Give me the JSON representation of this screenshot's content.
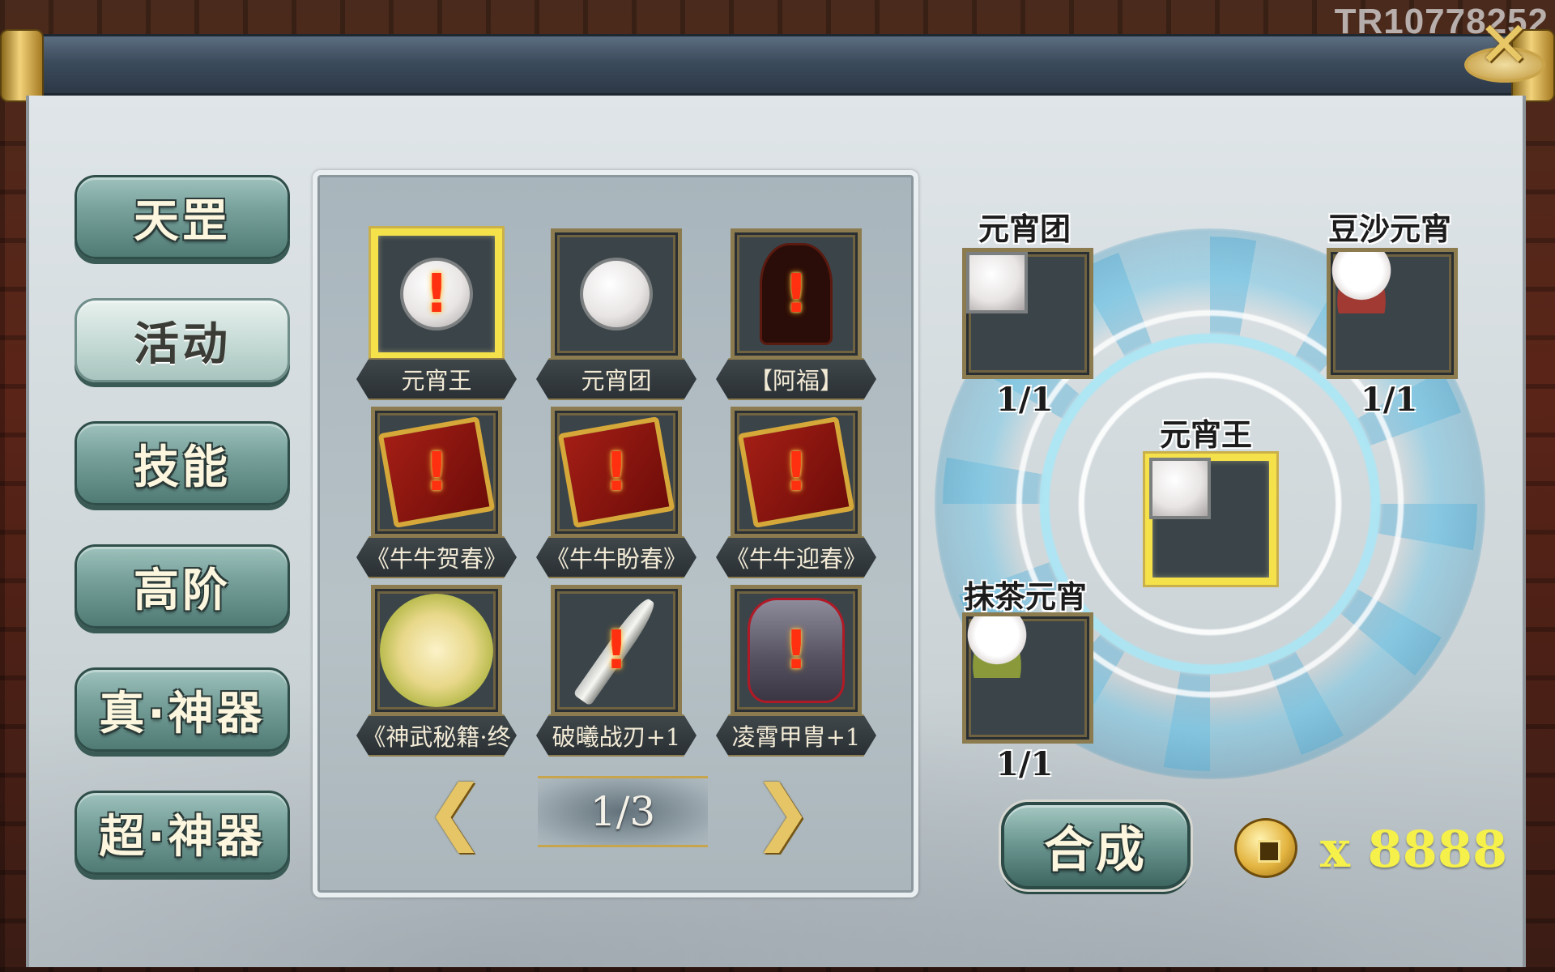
{
  "watermark": "TR10778252",
  "sidebar": {
    "items": [
      {
        "label": "天罡",
        "active": false
      },
      {
        "label": "活动",
        "active": true
      },
      {
        "label": "技能",
        "active": false
      },
      {
        "label": "高阶",
        "active": false
      },
      {
        "label": "真·神器",
        "active": false
      },
      {
        "label": "超·神器",
        "active": false
      }
    ]
  },
  "grid": {
    "items": [
      {
        "label": "元宵王",
        "icon": "yuanxiao-king-icon",
        "alert": "!",
        "selected": true
      },
      {
        "label": "元宵团",
        "icon": "yuanxiao-ball-icon",
        "alert": "",
        "selected": false
      },
      {
        "label": "【阿福】",
        "icon": "afu-icon",
        "alert": "!",
        "selected": false
      },
      {
        "label": "《牛牛贺春》",
        "icon": "book-icon",
        "alert": "!",
        "selected": false
      },
      {
        "label": "《牛牛盼春》",
        "icon": "book-icon",
        "alert": "!",
        "selected": false
      },
      {
        "label": "《牛牛迎春》",
        "icon": "book-icon",
        "alert": "!",
        "selected": false
      },
      {
        "label": "《神武秘籍·终",
        "icon": "scroll-icon",
        "alert": "",
        "selected": false
      },
      {
        "label": "破曦战刃+1",
        "icon": "blade-icon",
        "alert": "!",
        "selected": false
      },
      {
        "label": "凌霄甲胄+1",
        "icon": "armor-icon",
        "alert": "!",
        "selected": false
      }
    ]
  },
  "pagination": {
    "current": "1/3",
    "prev_icon": "arrow-left-icon",
    "next_icon": "arrow-right-icon"
  },
  "synthesis": {
    "materials": [
      {
        "name": "元宵团",
        "count": "1/1",
        "icon": "yuanxiao-ball-icon"
      },
      {
        "name": "豆沙元宵",
        "count": "1/1",
        "icon": "redbean-yuanxiao-icon"
      },
      {
        "name": "抹茶元宵",
        "count": "1/1",
        "icon": "matcha-yuanxiao-icon"
      }
    ],
    "result": {
      "name": "元宵王",
      "icon": "yuanxiao-king-icon"
    },
    "compose_label": "合成",
    "currency_icon": "copper-coin-icon",
    "currency_amount": "x 8888"
  },
  "colors": {
    "accent_gold": "#f5e24a",
    "button_teal": "#6e9993",
    "coin_text": "#f6f04a"
  }
}
